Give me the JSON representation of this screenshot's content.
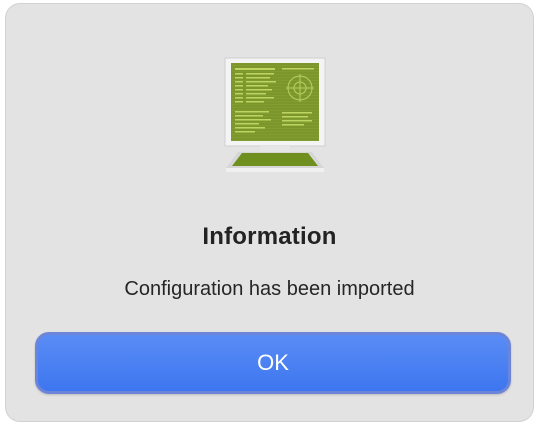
{
  "dialog": {
    "icon": "terminal-monitor-icon",
    "title": "Information",
    "message": "Configuration has been imported",
    "ok_label": "OK"
  },
  "colors": {
    "dialog_background": "#e3e3e3",
    "button_accent": "#4a80f2",
    "screen_green": "#7f9b2e"
  }
}
